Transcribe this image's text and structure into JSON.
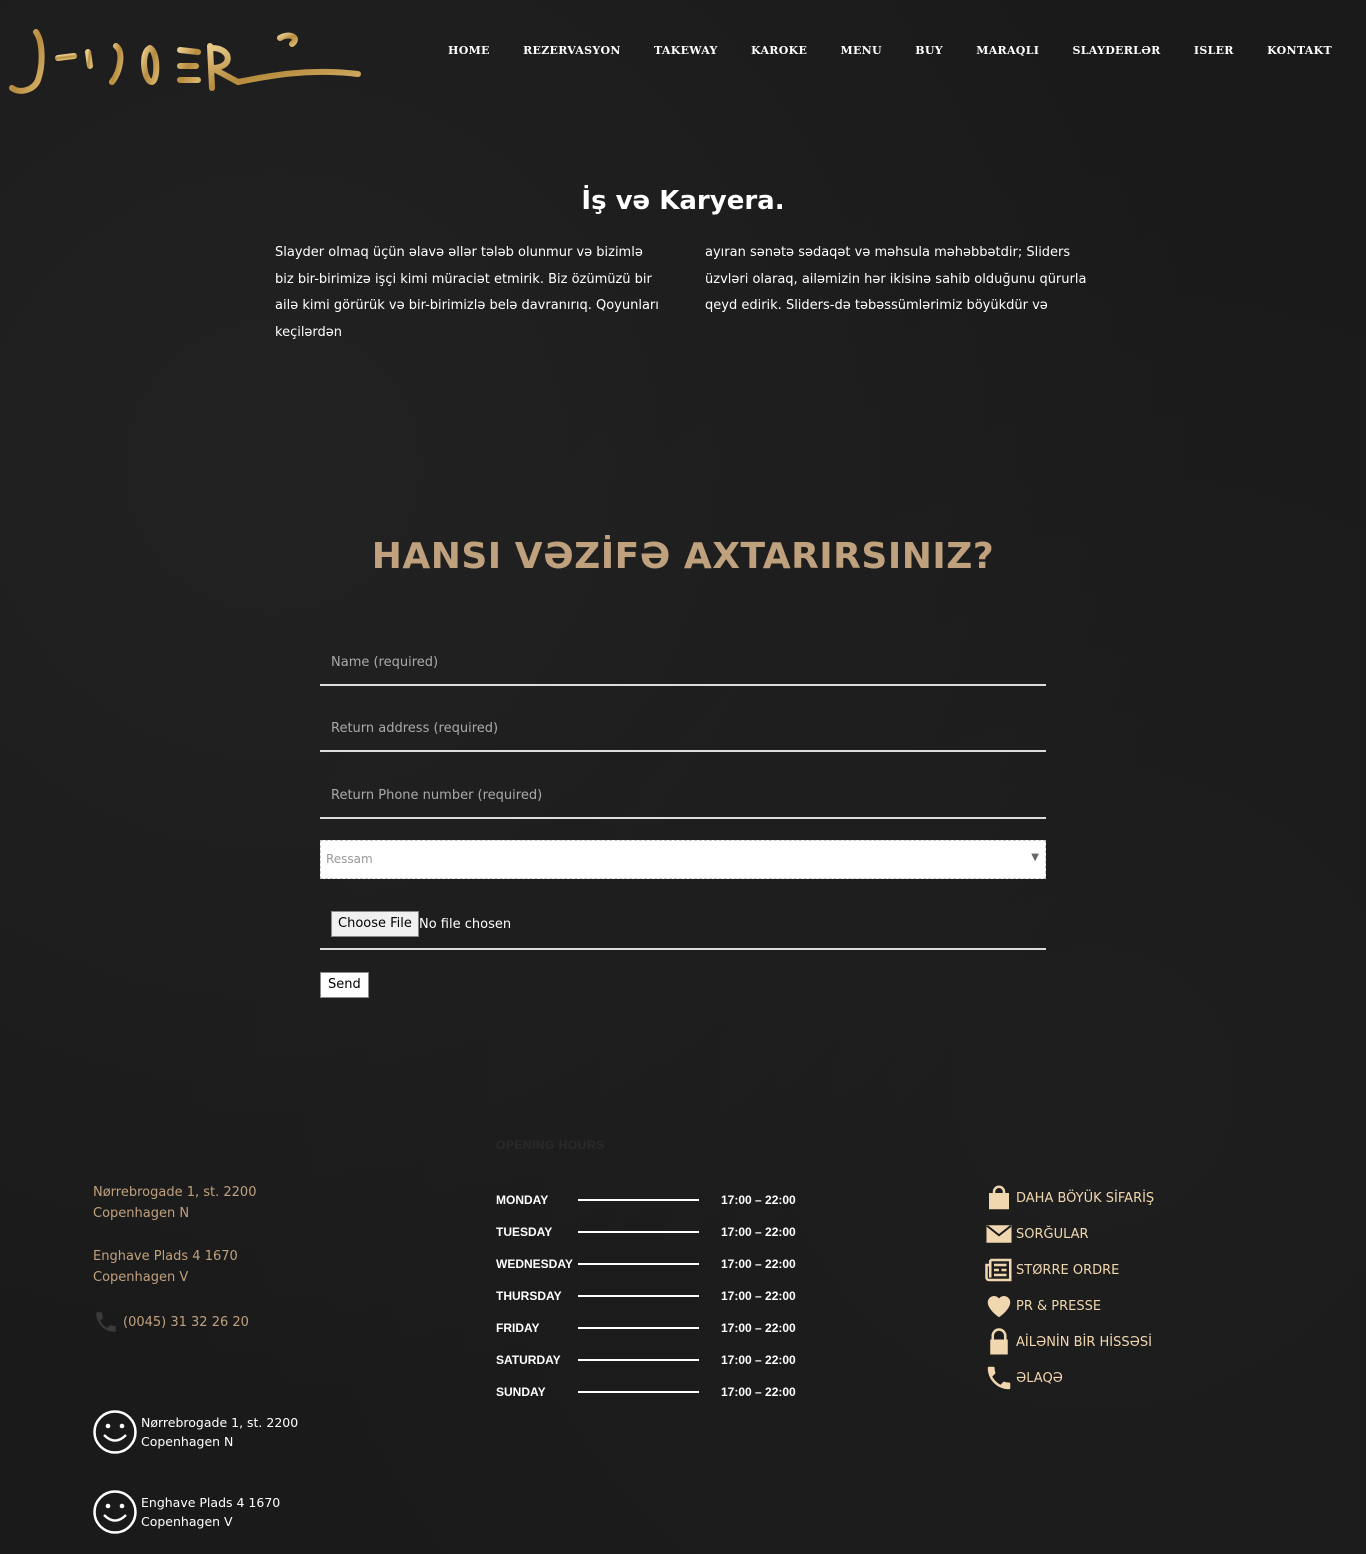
{
  "header": {
    "logo_text": "Sliders",
    "nav": [
      "HOME",
      "REZERVASYON",
      "TAKEWAY",
      "KAROKE",
      "MENU",
      "BUY",
      "MARAQLI",
      "SLAYDERLƏR",
      "ISLER",
      "KONTAKT"
    ]
  },
  "career": {
    "title": "İş və Karyera.",
    "col1": "Slayder olmaq üçün əlavə əllər tələb olunmur və bizimlə biz bir-birimizə işçi kimi müraciət etmirik. Biz özümüzü bir ailə kimi görürük və bir-birimizlə belə davranırıq. Qoyunları keçilərdən",
    "col2": "ayıran sənətə sədaqət və məhsula məhəbbətdir; Sliders üzvləri olaraq, ailəmizin hər ikisinə sahib olduğunu qürurla qeyd edirik. Sliders-də təbəssümlərimiz böyükdür və"
  },
  "form": {
    "title": "HANSI VƏZİFƏ AXTARIRSINIZ?",
    "name_placeholder": "Name (required)",
    "address_placeholder": "Return address (required)",
    "phone_placeholder": "Return Phone number (required)",
    "position_selected": "Ressam",
    "file_button": "Choose File",
    "file_status": "No file chosen",
    "send_label": "Send"
  },
  "footer": {
    "address1_line1": "Nørrebrogade 1, st. 2200",
    "address1_line2": "Copenhagen N",
    "address2_line1": "Enghave Plads 4 1670",
    "address2_line2": "Copenhagen V",
    "phone": "(0045) 31 32 26 20",
    "opening_title": "OPENING HOURS",
    "hours": [
      {
        "day": "MONDAY",
        "time": "17:00 – 22:00"
      },
      {
        "day": "TUESDAY",
        "time": "17:00 – 22:00"
      },
      {
        "day": "WEDNESDAY",
        "time": "17:00 – 22:00"
      },
      {
        "day": "THURSDAY",
        "time": "17:00 – 22:00"
      },
      {
        "day": "FRIDAY",
        "time": "17:00 – 22:00"
      },
      {
        "day": "SATURDAY",
        "time": "17:00 – 22:00"
      },
      {
        "day": "SUNDAY",
        "time": "17:00 – 22:00"
      }
    ],
    "links": [
      {
        "icon": "shopping-bag-icon",
        "label": "DAHA BÖYÜK SİFARİŞ"
      },
      {
        "icon": "envelope-icon",
        "label": "SORĞULAR"
      },
      {
        "icon": "newspaper-icon",
        "label": "STØRRE ORDRE"
      },
      {
        "icon": "heart-icon",
        "label": "PR & PRESSE"
      },
      {
        "icon": "lock-icon",
        "label": "AİLƏNİN BİR HİSSƏSİ"
      },
      {
        "icon": "phone-icon",
        "label": "ƏLAQƏ"
      }
    ],
    "locations": [
      {
        "line1": "Nørrebrogade 1, st. 2200",
        "line2": "Copenhagen N"
      },
      {
        "line1": "Enghave Plads 4 1670",
        "line2": "Copenhagen V"
      }
    ]
  },
  "colors": {
    "background": "#1a1a1a",
    "gold": "#c0a17e",
    "light_gold": "#f1d7b0"
  }
}
